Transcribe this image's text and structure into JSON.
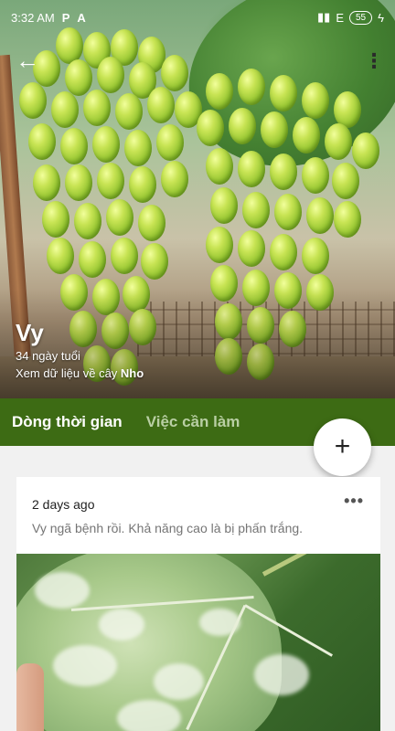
{
  "status_bar": {
    "time": "3:32 AM",
    "icons_left": [
      "P",
      "A"
    ],
    "network": "E",
    "battery": "55"
  },
  "header": {
    "back_icon": "arrow-left-icon",
    "more_icon": "more-vert-icon"
  },
  "plant": {
    "name": "Vy",
    "age": "34 ngày tuổi",
    "link_prefix": "Xem dữ liệu về cây ",
    "link_plant": "Nho"
  },
  "tabs": [
    {
      "label": "Dòng thời gian",
      "active": true
    },
    {
      "label": "Việc cần làm",
      "active": false
    }
  ],
  "fab": {
    "icon": "plus-icon",
    "label": "+"
  },
  "card": {
    "date": "2 days ago",
    "menu_label": "•••",
    "text": "Vy ngã bệnh rồi. Khả năng cao là bị phấn trắng."
  },
  "colors": {
    "tab_bar": "#3d6b14",
    "tab_inactive": "#b9cfa4",
    "card_text": "#757575"
  }
}
